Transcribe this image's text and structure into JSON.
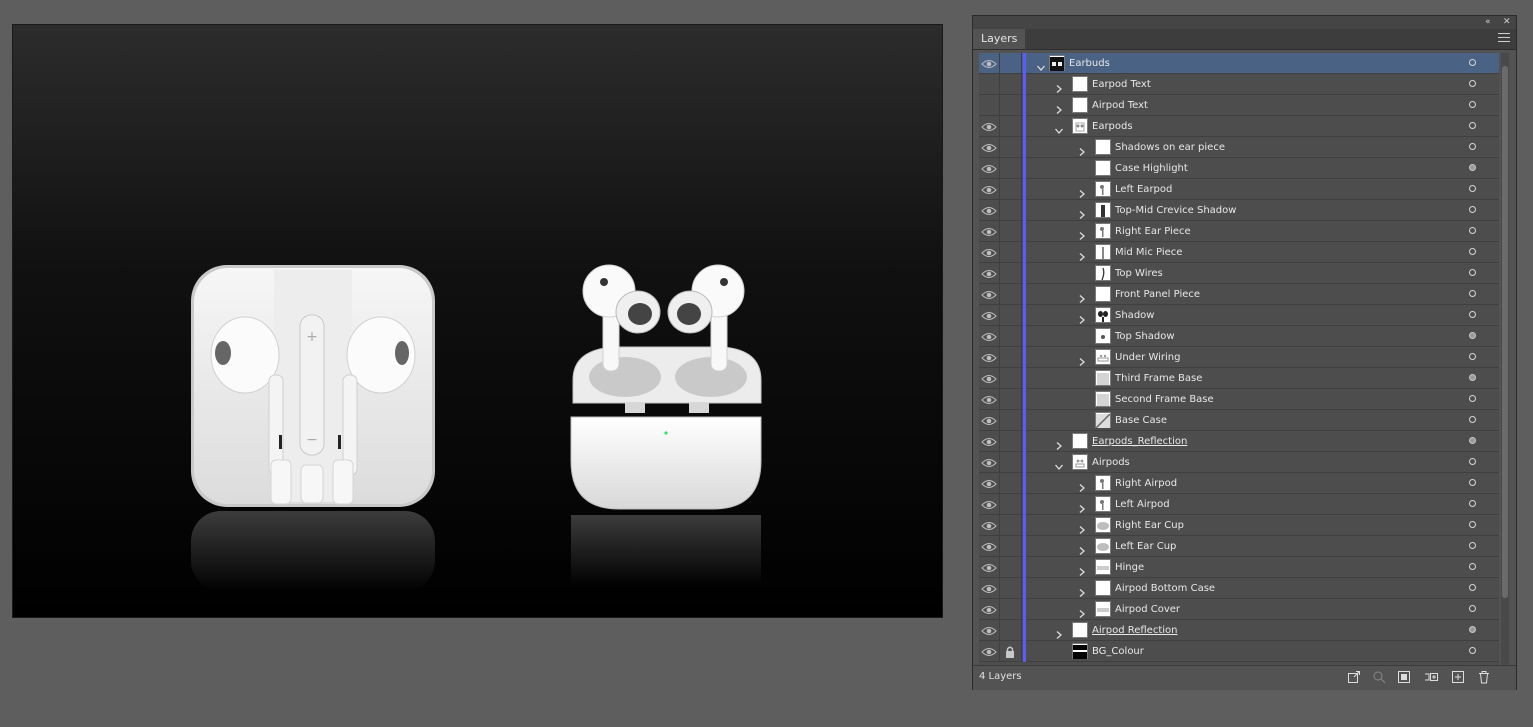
{
  "panel": {
    "tab_label": "Layers",
    "collapse_glyph": "«",
    "close_glyph": "✕",
    "footer_count": "4 Layers",
    "footer_icons": [
      "export-icon",
      "locate-object-icon",
      "clipping-mask-icon",
      "new-sublayer-icon",
      "new-layer-icon",
      "trash-icon"
    ]
  },
  "layers": [
    {
      "name": "Earbuds",
      "level": 0,
      "expanded": true,
      "visible": true,
      "selected": true,
      "target": "hollow",
      "underline": false,
      "thumb": "earbuds",
      "chevron": true
    },
    {
      "name": "Earpod Text",
      "level": 1,
      "expanded": false,
      "visible": false,
      "target": "hollow",
      "thumb": "blank",
      "chevron": true
    },
    {
      "name": "Airpod Text",
      "level": 1,
      "expanded": false,
      "visible": false,
      "target": "hollow",
      "thumb": "blank",
      "chevron": true
    },
    {
      "name": "Earpods",
      "level": 1,
      "expanded": true,
      "visible": true,
      "target": "hollow",
      "thumb": "earpods",
      "chevron": true
    },
    {
      "name": "Shadows on ear piece",
      "level": 2,
      "expanded": false,
      "visible": true,
      "target": "hollow",
      "thumb": "blank",
      "chevron": true
    },
    {
      "name": "Case Highlight",
      "level": 2,
      "visible": true,
      "target": "filled",
      "thumb": "blank",
      "chevron": false
    },
    {
      "name": "Left Earpod",
      "level": 2,
      "visible": true,
      "target": "hollow",
      "thumb": "earpiece",
      "chevron": true
    },
    {
      "name": "Top-Mid Crevice Shadow",
      "level": 2,
      "visible": true,
      "target": "hollow",
      "thumb": "dark-strip",
      "chevron": true
    },
    {
      "name": "Right Ear Piece",
      "level": 2,
      "visible": true,
      "target": "hollow",
      "thumb": "earpiece",
      "chevron": true
    },
    {
      "name": "Mid Mic Piece",
      "level": 2,
      "visible": true,
      "target": "hollow",
      "thumb": "mic",
      "chevron": true
    },
    {
      "name": "Top Wires",
      "level": 2,
      "visible": true,
      "target": "hollow",
      "thumb": "wire",
      "chevron": false
    },
    {
      "name": "Front Panel Piece",
      "level": 2,
      "visible": true,
      "target": "hollow",
      "thumb": "blank",
      "chevron": true
    },
    {
      "name": "Shadow",
      "level": 2,
      "visible": true,
      "target": "hollow",
      "thumb": "shadow",
      "chevron": true
    },
    {
      "name": "Top Shadow",
      "level": 2,
      "visible": true,
      "target": "filled",
      "thumb": "dot",
      "chevron": false
    },
    {
      "name": "Under Wiring",
      "level": 2,
      "visible": true,
      "target": "hollow",
      "thumb": "wiring",
      "chevron": true
    },
    {
      "name": "Third Frame Base",
      "level": 2,
      "visible": true,
      "target": "filled",
      "thumb": "grey",
      "chevron": false
    },
    {
      "name": "Second Frame Base",
      "level": 2,
      "visible": true,
      "target": "hollow",
      "thumb": "grey",
      "chevron": false
    },
    {
      "name": "Base Case",
      "level": 2,
      "visible": true,
      "target": "hollow",
      "thumb": "diag",
      "chevron": false
    },
    {
      "name": "Earpods_Reflection",
      "level": 1,
      "expanded": false,
      "visible": true,
      "target": "filled",
      "underline": true,
      "thumb": "blank",
      "chevron": true
    },
    {
      "name": "Airpods",
      "level": 1,
      "expanded": true,
      "visible": true,
      "target": "hollow",
      "thumb": "airpods",
      "chevron": true
    },
    {
      "name": "Right Airpod",
      "level": 2,
      "visible": true,
      "target": "hollow",
      "thumb": "earpiece",
      "chevron": true
    },
    {
      "name": "Left Airpod",
      "level": 2,
      "visible": true,
      "target": "hollow",
      "thumb": "earpiece",
      "chevron": true
    },
    {
      "name": "Right Ear Cup",
      "level": 2,
      "visible": true,
      "target": "hollow",
      "thumb": "cup",
      "chevron": true
    },
    {
      "name": "Left Ear Cup",
      "level": 2,
      "visible": true,
      "target": "hollow",
      "thumb": "cup",
      "chevron": true
    },
    {
      "name": "Hinge",
      "level": 2,
      "visible": true,
      "target": "hollow",
      "thumb": "hinge",
      "chevron": true
    },
    {
      "name": "Airpod Bottom Case",
      "level": 2,
      "visible": true,
      "target": "hollow",
      "thumb": "blank",
      "chevron": true
    },
    {
      "name": "Airpod Cover",
      "level": 2,
      "visible": true,
      "target": "hollow",
      "thumb": "hinge",
      "chevron": true
    },
    {
      "name": "Airpod Reflection",
      "level": 1,
      "expanded": false,
      "visible": true,
      "target": "filled",
      "underline": true,
      "thumb": "blank",
      "chevron": true
    },
    {
      "name": "BG_Colour",
      "level": 1,
      "visible": true,
      "locked": true,
      "target": "hollow",
      "thumb": "bg",
      "chevron": false
    }
  ],
  "colors": {
    "layer_color": "#5b5bff",
    "selection": "#4a6284",
    "led": "#3ddc6a"
  }
}
